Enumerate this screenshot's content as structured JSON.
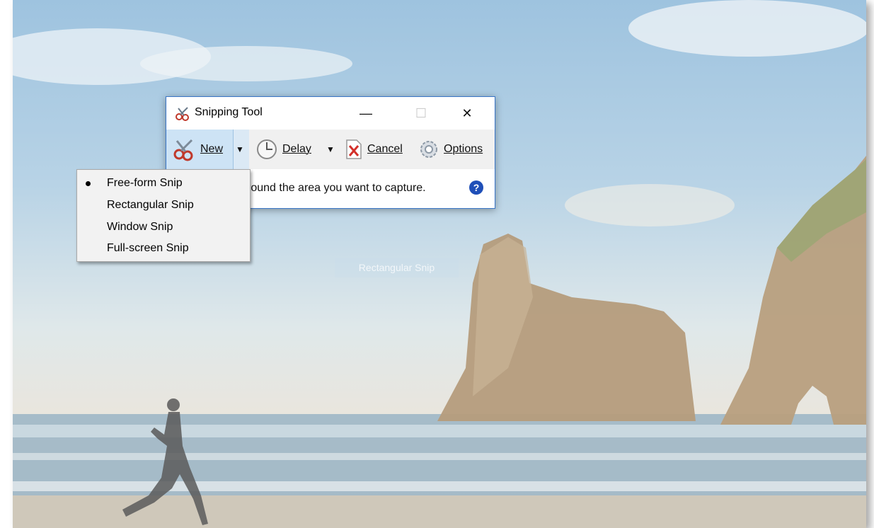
{
  "window": {
    "title": "Snipping Tool",
    "controls": {
      "minimize": "—",
      "maximize": "☐",
      "close": "✕"
    }
  },
  "toolbar": {
    "new_label": "New",
    "delay_label": "Delay",
    "cancel_label": "Cancel",
    "options_label": "Options"
  },
  "status": {
    "text": "round the area you want to capture.",
    "help": "?"
  },
  "menu": {
    "items": [
      {
        "label": "Free-form Snip",
        "selected": true
      },
      {
        "label": "Rectangular Snip",
        "selected": false
      },
      {
        "label": "Window Snip",
        "selected": false
      },
      {
        "label": "Full-screen Snip",
        "selected": false
      }
    ]
  },
  "background": {
    "ghost_label": "Rectangular Snip"
  },
  "colors": {
    "accent": "#3a76c8",
    "new_button_active": "#cde3f5",
    "help_icon": "#1f4fb8"
  }
}
